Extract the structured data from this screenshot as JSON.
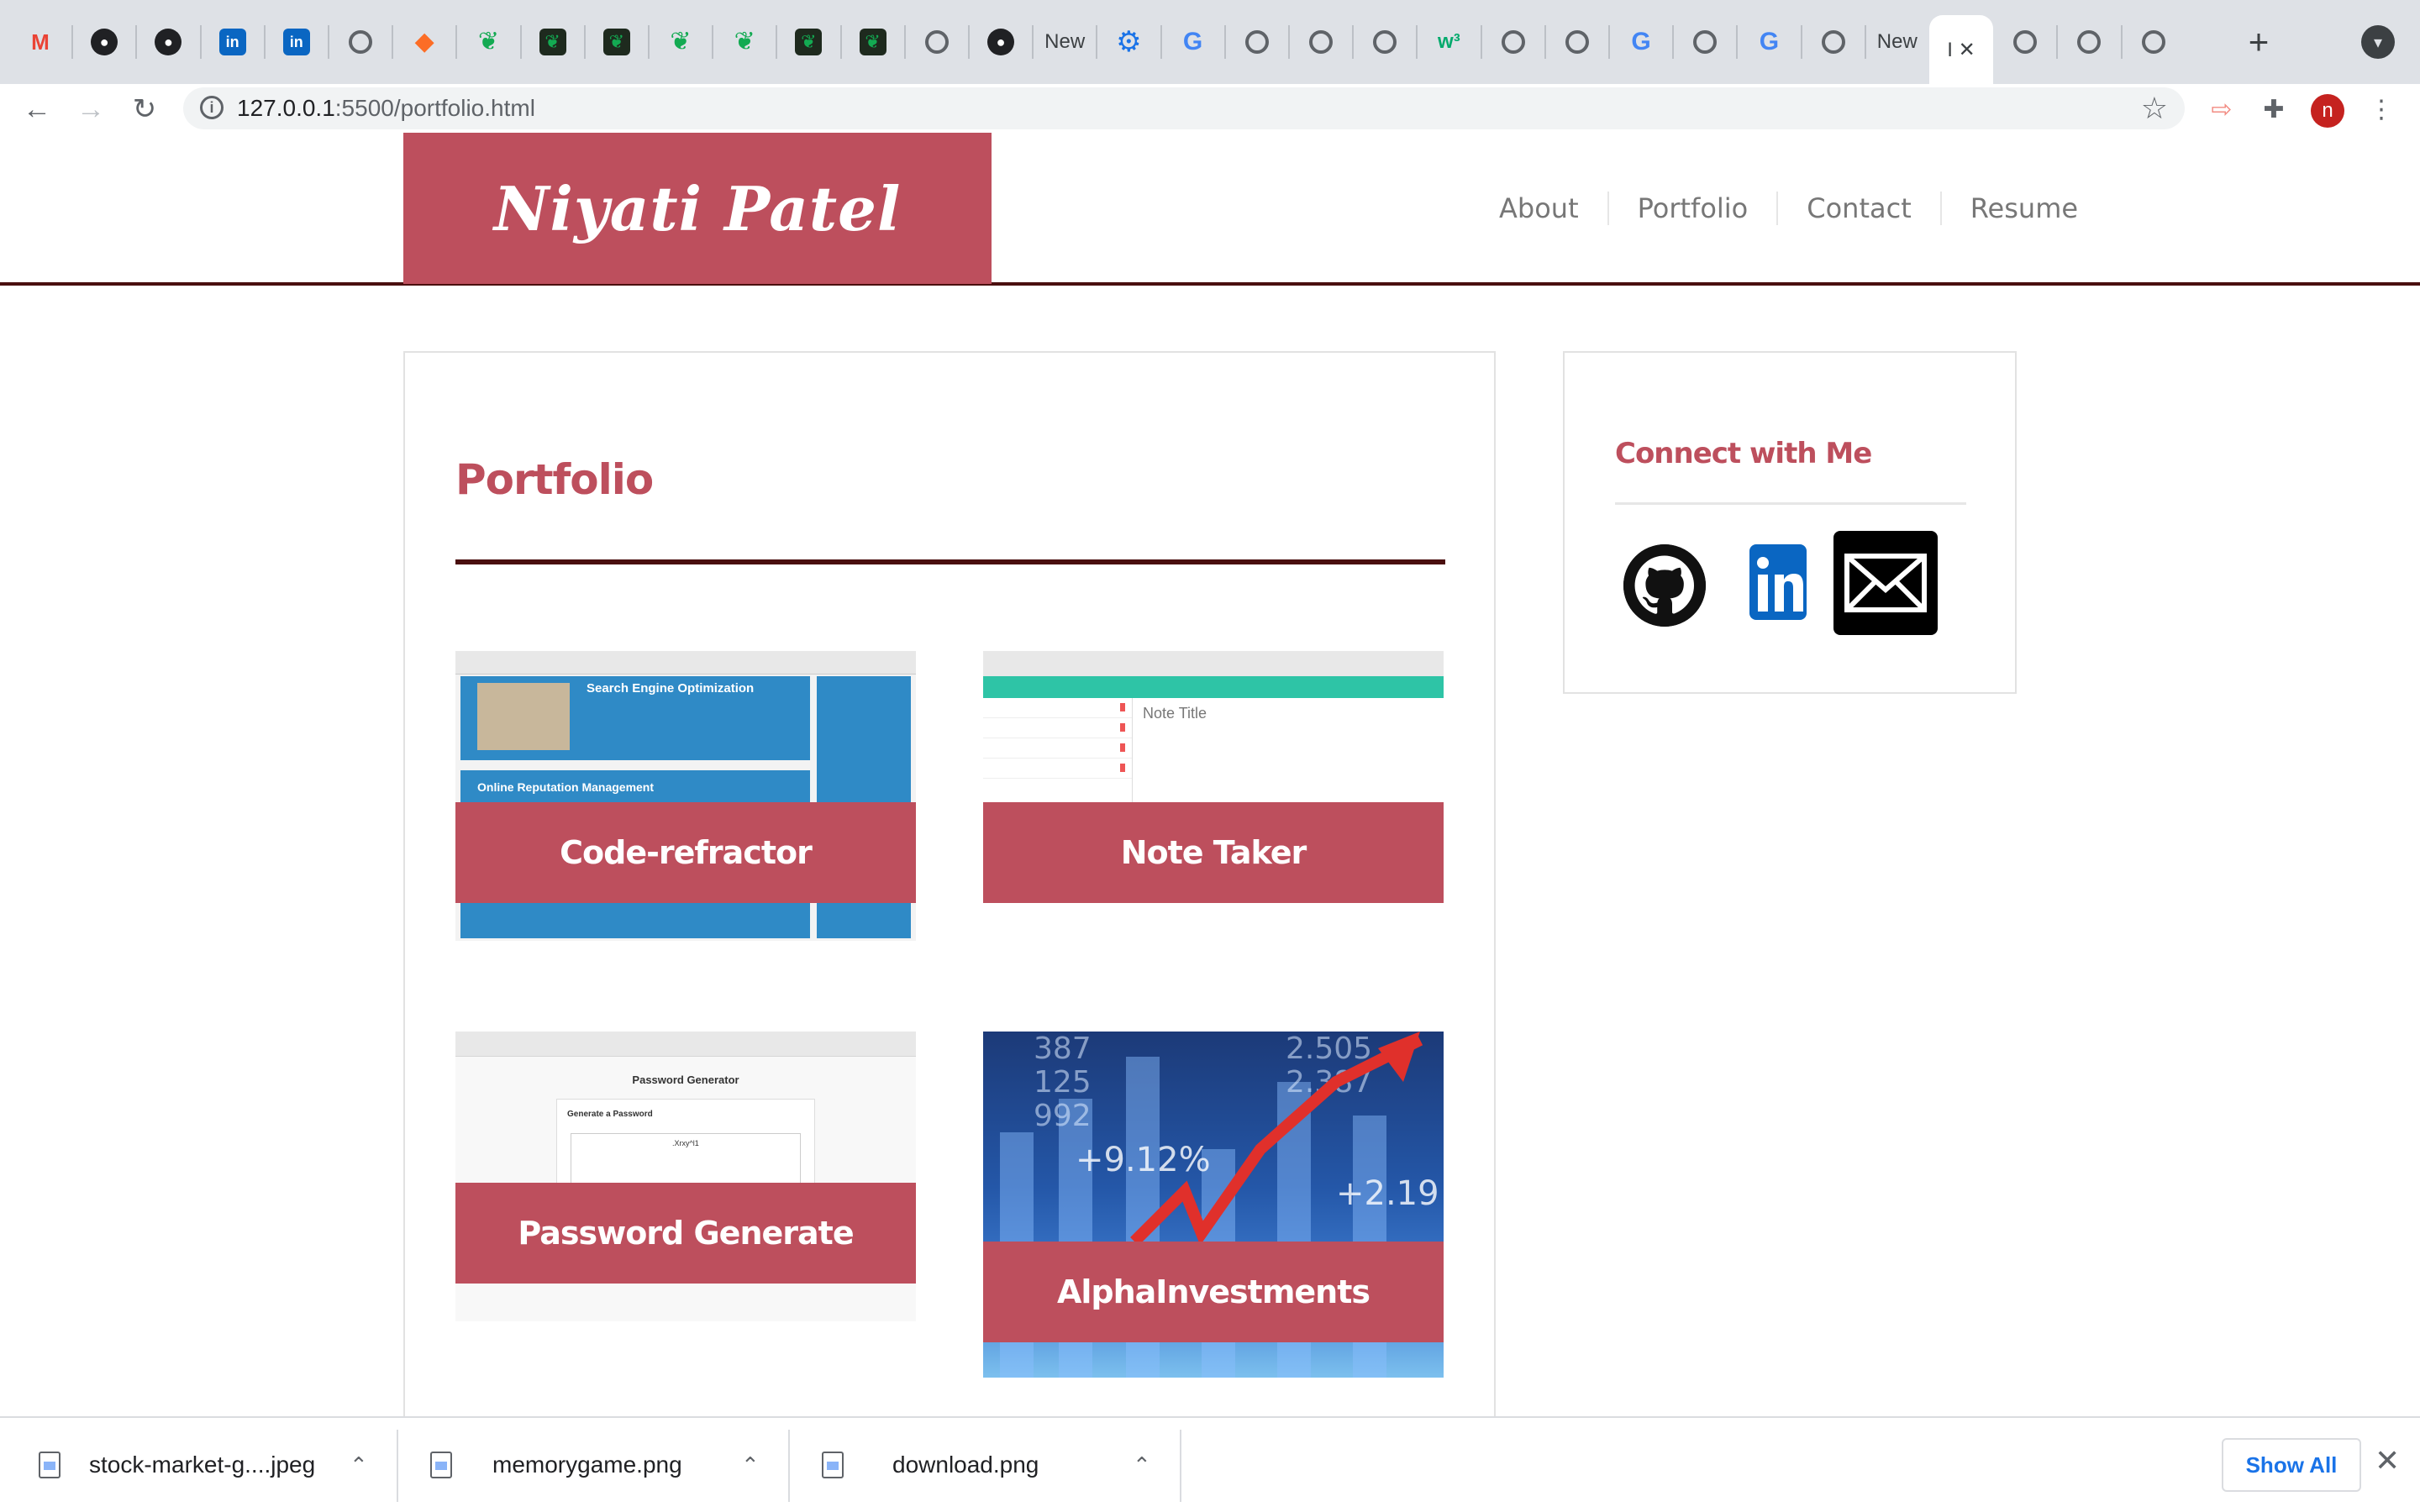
{
  "browser": {
    "tabs": [
      {
        "icon": "gmail-icon",
        "glyph": "M",
        "cls": "ic-gmail"
      },
      {
        "icon": "github-icon",
        "glyph": "●",
        "cls": "ic-gh"
      },
      {
        "icon": "github-icon",
        "glyph": "●",
        "cls": "ic-gh"
      },
      {
        "icon": "linkedin-icon",
        "glyph": "in",
        "cls": "ic-in"
      },
      {
        "icon": "linkedin-icon",
        "glyph": "in",
        "cls": "ic-in"
      },
      {
        "icon": "globe-icon",
        "glyph": "",
        "cls": "ic-globe"
      },
      {
        "icon": "gitlab-icon",
        "glyph": "◆",
        "cls": "ic-gitlab"
      },
      {
        "icon": "mongodb-leaf-icon",
        "glyph": "❦",
        "cls": "ic-leaf"
      },
      {
        "icon": "mongodb-dark-icon",
        "glyph": "❦",
        "cls": "ic-leafdark"
      },
      {
        "icon": "mongodb-dark-icon",
        "glyph": "❦",
        "cls": "ic-leafdark"
      },
      {
        "icon": "mongodb-leaf-icon",
        "glyph": "❦",
        "cls": "ic-leaf"
      },
      {
        "icon": "mongodb-leaf-icon",
        "glyph": "❦",
        "cls": "ic-leaf"
      },
      {
        "icon": "mongodb-dark-icon",
        "glyph": "❦",
        "cls": "ic-leafdark"
      },
      {
        "icon": "mongodb-dark-icon",
        "glyph": "❦",
        "cls": "ic-leafdark"
      },
      {
        "icon": "globe-icon",
        "glyph": "",
        "cls": "ic-globe"
      },
      {
        "icon": "github-icon",
        "glyph": "●",
        "cls": "ic-gh"
      },
      {
        "icon": "text",
        "label": "New"
      },
      {
        "icon": "settings-gear-icon",
        "glyph": "⚙",
        "cls": "ic-gear"
      },
      {
        "icon": "google-icon",
        "glyph": "G",
        "cls": "ic-g"
      },
      {
        "icon": "globe-icon",
        "glyph": "",
        "cls": "ic-globe"
      },
      {
        "icon": "globe-icon",
        "glyph": "",
        "cls": "ic-globe"
      },
      {
        "icon": "globe-icon",
        "glyph": "",
        "cls": "ic-globe"
      },
      {
        "icon": "w3schools-icon",
        "glyph": "w³",
        "cls": "ic-w3"
      },
      {
        "icon": "globe-icon",
        "glyph": "",
        "cls": "ic-globe"
      },
      {
        "icon": "globe-icon",
        "glyph": "",
        "cls": "ic-globe"
      },
      {
        "icon": "google-icon",
        "glyph": "G",
        "cls": "ic-g"
      },
      {
        "icon": "globe-icon",
        "glyph": "",
        "cls": "ic-globe"
      },
      {
        "icon": "google-icon",
        "glyph": "G",
        "cls": "ic-g"
      },
      {
        "icon": "globe-icon",
        "glyph": "",
        "cls": "ic-globe"
      },
      {
        "icon": "text",
        "label": "New"
      },
      {
        "icon": "active",
        "label": "I ✕"
      },
      {
        "icon": "globe-icon",
        "glyph": "",
        "cls": "ic-globe"
      },
      {
        "icon": "globe-icon",
        "glyph": "",
        "cls": "ic-globe"
      },
      {
        "icon": "globe-icon",
        "glyph": "",
        "cls": "ic-globe"
      }
    ],
    "new_tab_label": "+",
    "url_host": "127.0.0.1",
    "url_rest": ":5500/portfolio.html",
    "avatar_letter": "n"
  },
  "site": {
    "logo": "Niyati Patel",
    "nav": [
      "About",
      "Portfolio",
      "Contact",
      "Resume"
    ],
    "section_title": "Portfolio",
    "projects": [
      {
        "label": "Code-refractor"
      },
      {
        "label": "Note Taker"
      },
      {
        "label": "Password Generate"
      },
      {
        "label": "AlphaInvestments"
      }
    ],
    "thumbs": {
      "code_h1": "Search Engine Optimization",
      "code_h2": "Online Reputation Management",
      "note_title": "Note Title",
      "pw_title": "Password Generator",
      "pw_card": "Generate a Password",
      "pw_value": ".Xrxy^l1",
      "stock_pct1": "+9.12%",
      "stock_pct2": "+2.19"
    },
    "sidebar_title": "Connect with Me"
  },
  "downloads": {
    "items": [
      "stock-market-g....jpeg",
      "memorygame.png",
      "download.png"
    ],
    "show_all": "Show All"
  }
}
